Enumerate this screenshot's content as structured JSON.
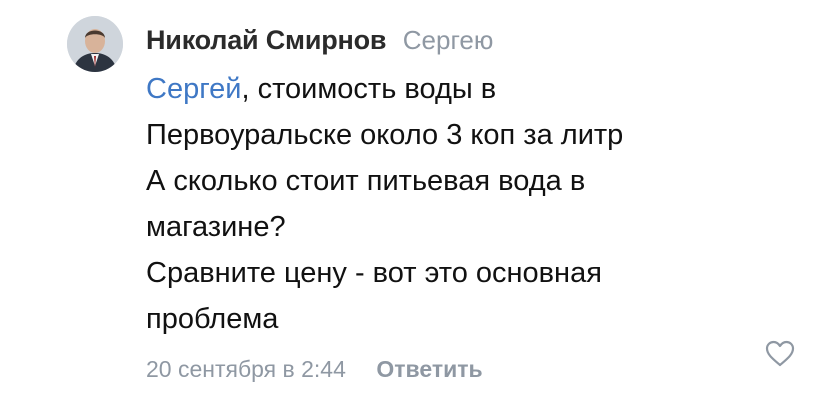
{
  "comment": {
    "author": "Николай Смирнов",
    "reply_to": "Сергею",
    "mention": "Сергей",
    "lines": [
      ", стоимость воды в",
      "Первоуральске около 3 коп за литр",
      "А сколько стоит питьевая вода в",
      "магазине?",
      "Сравните цену - вот это основная",
      "проблема"
    ],
    "date": "20 сентября в 2:44",
    "reply_label": "Ответить"
  },
  "icons": {
    "like": "heart-icon",
    "avatar": "user-photo"
  },
  "colors": {
    "link": "#3f78c5",
    "secondary": "#8f98a3",
    "text": "#111111"
  }
}
